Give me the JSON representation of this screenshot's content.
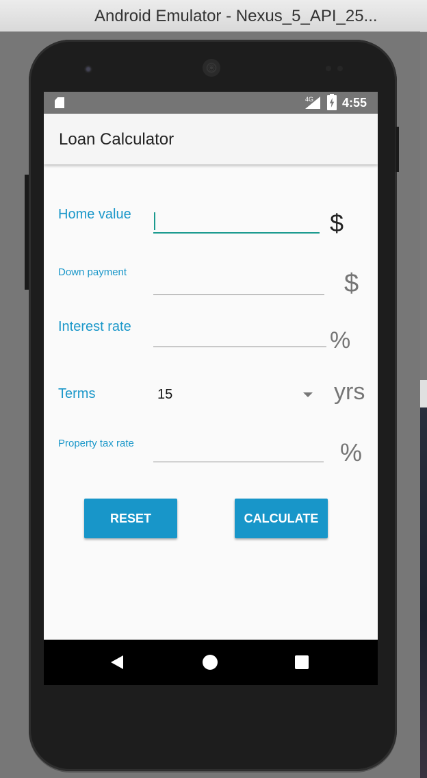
{
  "window": {
    "title": "Android Emulator - Nexus_5_API_25..."
  },
  "statusbar": {
    "network": "4G",
    "time": "4:55"
  },
  "app": {
    "title": "Loan Calculator"
  },
  "form": {
    "home_value": {
      "label": "Home value",
      "value": "",
      "unit": "$"
    },
    "down_payment": {
      "label": "Down payment",
      "value": "",
      "unit": "$"
    },
    "interest_rate": {
      "label": "Interest rate",
      "value": "",
      "unit": "%"
    },
    "terms": {
      "label": "Terms",
      "selected": "15",
      "unit": "yrs"
    },
    "property_tax_rate": {
      "label": "Property tax rate",
      "value": "",
      "unit": "%"
    }
  },
  "buttons": {
    "reset": "RESET",
    "calculate": "CALCULATE"
  },
  "colors": {
    "accent": "#1a97c9",
    "button": "#1896c9",
    "focus_line": "#1a9a8e",
    "statusbar": "#757575"
  },
  "icons": {
    "sd": "sd-card-icon",
    "signal": "signal-icon",
    "battery": "battery-charging-icon",
    "back": "back-icon",
    "home": "home-icon",
    "recents": "recents-icon"
  }
}
